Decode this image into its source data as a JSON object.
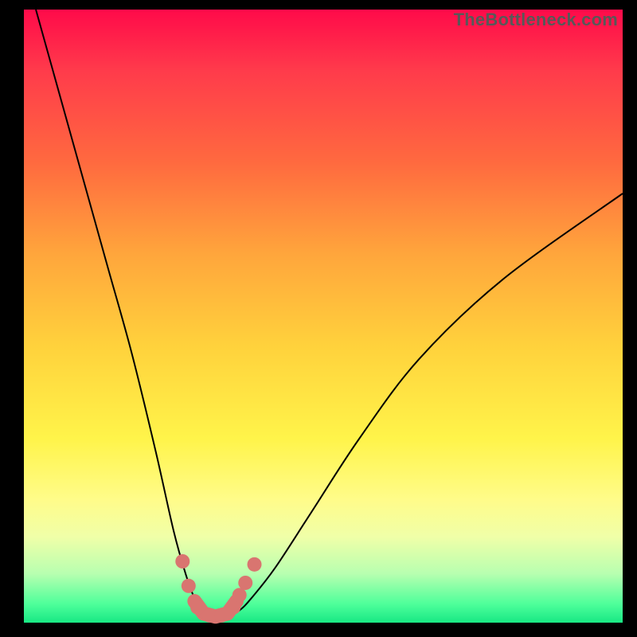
{
  "watermark": "TheBottleneck.com",
  "colors": {
    "curve": "#000000",
    "points": "#d97570",
    "valley_stroke": "#d97570",
    "gradient_top": "#ff0a4a",
    "gradient_bottom": "#18e884",
    "frame": "#000000"
  },
  "chart_data": {
    "type": "line",
    "title": "",
    "xlabel": "",
    "ylabel": "",
    "xlim": [
      0,
      100
    ],
    "ylim": [
      0,
      100
    ],
    "grid": false,
    "legend": false,
    "series": [
      {
        "name": "bottleneck-curve",
        "x": [
          2,
          6,
          10,
          14,
          18,
          22,
          25,
          27,
          28.5,
          30,
          32,
          34,
          36,
          38,
          42,
          48,
          56,
          66,
          80,
          100
        ],
        "y": [
          100,
          86,
          72,
          58,
          44,
          28,
          15,
          8,
          4,
          2,
          1,
          1,
          2,
          4,
          9,
          18,
          30,
          43,
          56,
          70
        ]
      }
    ],
    "highlight_points": [
      {
        "x": 26.5,
        "y": 10
      },
      {
        "x": 27.5,
        "y": 6
      },
      {
        "x": 29,
        "y": 2.5
      },
      {
        "x": 31,
        "y": 1.2
      },
      {
        "x": 33,
        "y": 1.2
      },
      {
        "x": 35,
        "y": 2.5
      },
      {
        "x": 36,
        "y": 4.5
      },
      {
        "x": 37,
        "y": 6.5
      },
      {
        "x": 38.5,
        "y": 9.5
      }
    ],
    "valley_path": [
      {
        "x": 28.5,
        "y": 3.5
      },
      {
        "x": 30,
        "y": 1.5
      },
      {
        "x": 32,
        "y": 1.0
      },
      {
        "x": 34,
        "y": 1.5
      },
      {
        "x": 35.5,
        "y": 3.5
      }
    ]
  }
}
